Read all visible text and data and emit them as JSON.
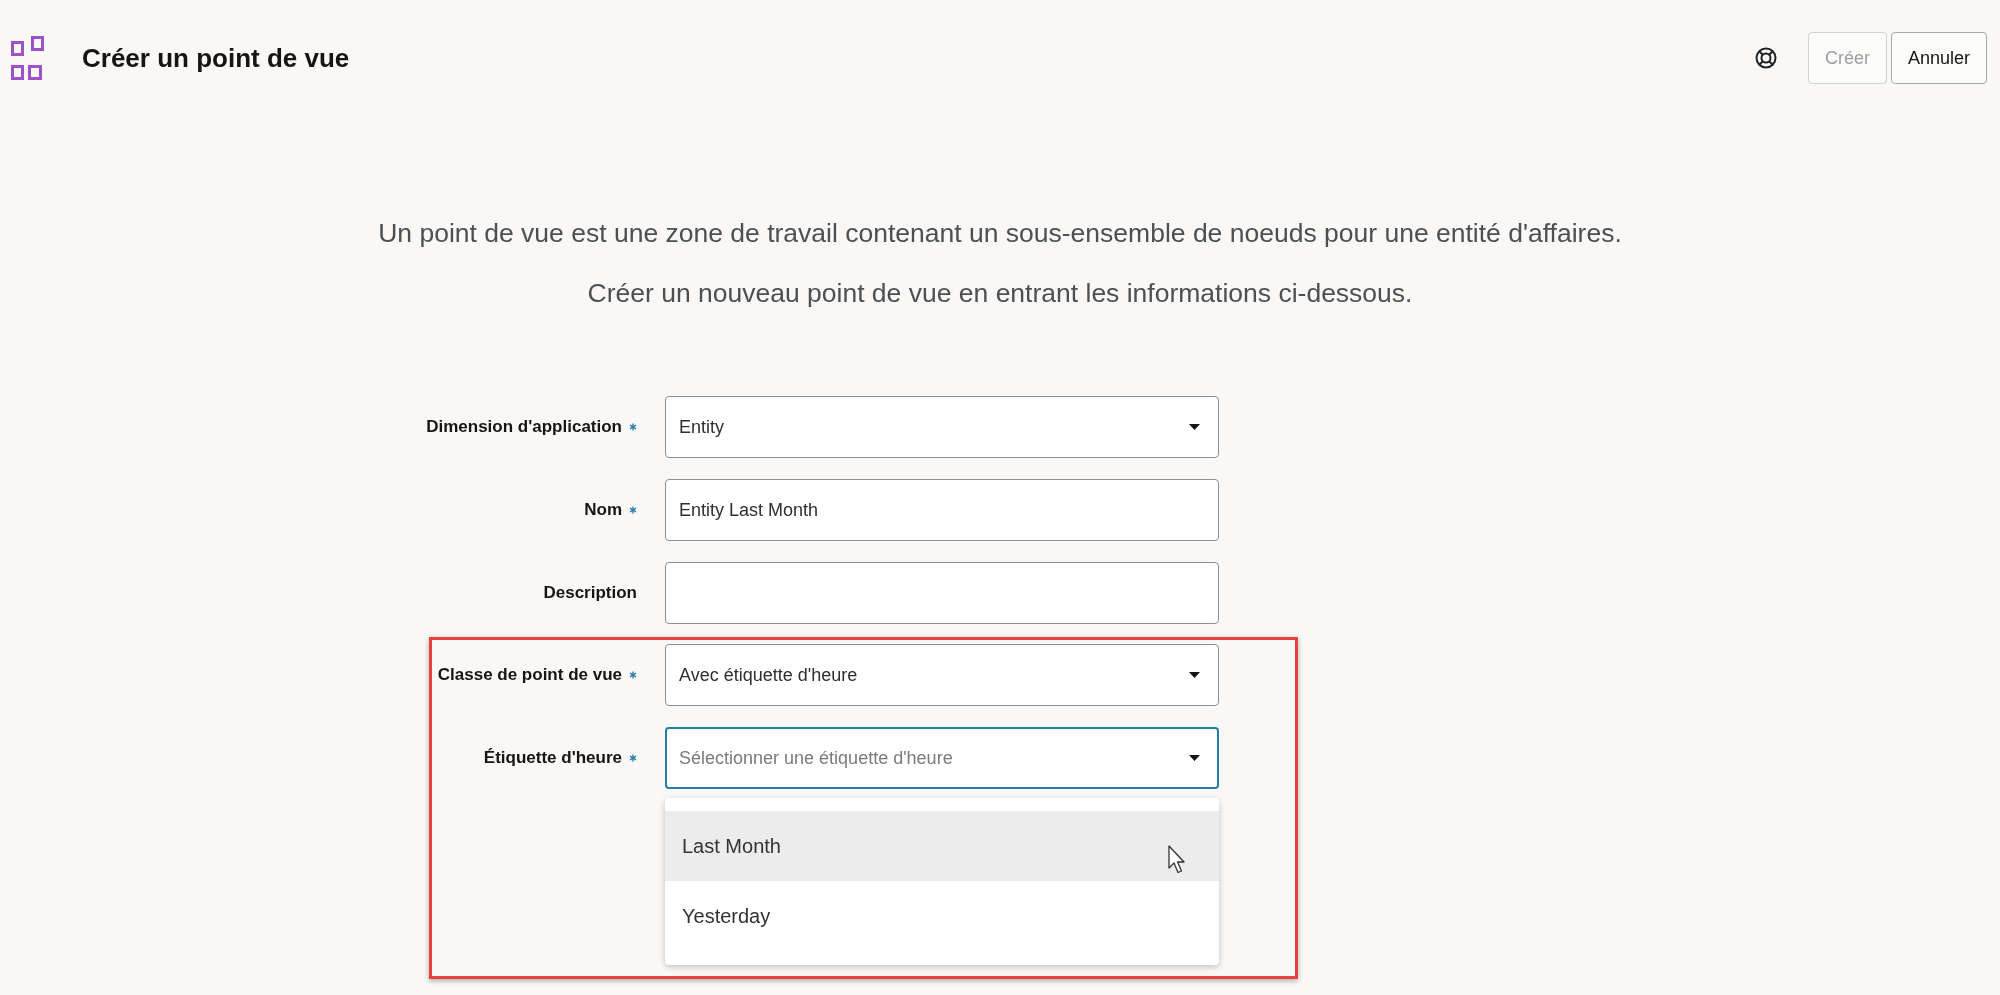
{
  "header": {
    "title": "Créer un point de vue",
    "buttons": [
      {
        "label": "Créer",
        "disabled": true
      },
      {
        "label": "Annuler",
        "disabled": false
      }
    ]
  },
  "intro": [
    "Un point de vue est une zone de travail contenant un sous-ensemble de noeuds pour une entité d'affaires.",
    "Créer un nouveau point de vue en entrant les informations ci-dessous."
  ],
  "form": {
    "fields": [
      {
        "label": "Dimension d'application",
        "required": true,
        "kind": "select",
        "value": "Entity",
        "focused": false,
        "highlighted": false
      },
      {
        "label": "Nom",
        "required": true,
        "kind": "text",
        "value": "Entity Last Month",
        "focused": false,
        "highlighted": false
      },
      {
        "label": "Description",
        "required": false,
        "kind": "text",
        "focused": false,
        "highlighted": false
      },
      {
        "label": "Classe de point de vue",
        "required": true,
        "kind": "select",
        "value": "Avec étiquette d'heure",
        "focused": false,
        "highlighted": true
      },
      {
        "label": "Étiquette d'heure",
        "required": true,
        "kind": "select",
        "placeholder": "Sélectionner une étiquette d'heure",
        "focused": true,
        "expanded": true,
        "highlighted": true,
        "options": [
          {
            "label": "Last Month",
            "selected": true
          },
          {
            "label": "Yesterday",
            "selected": false
          }
        ]
      }
    ]
  }
}
